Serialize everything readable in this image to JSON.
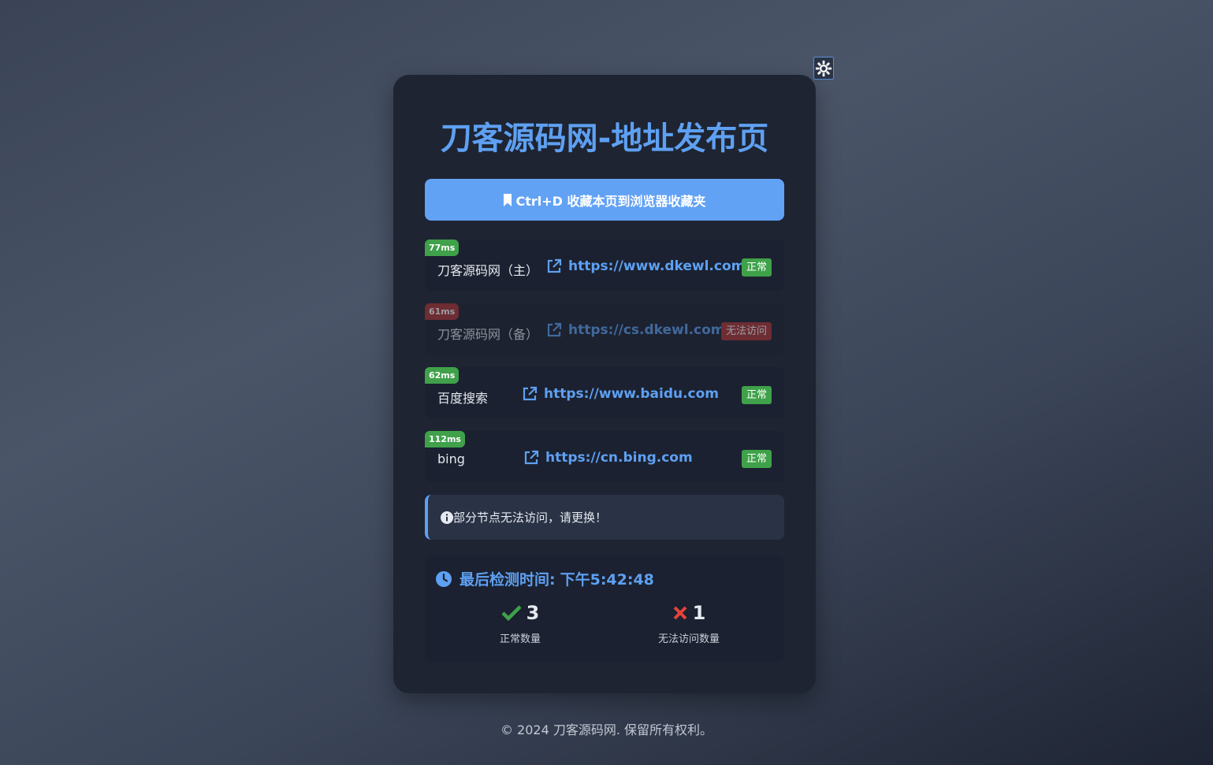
{
  "title": "刀客源码网-地址发布页",
  "bookmark": {
    "label": "Ctrl+D 收藏本页到浏览器收藏夹"
  },
  "links": [
    {
      "latency": "77ms",
      "name": "刀客源码网（主）",
      "url": "https://www.dkewl.com",
      "status": "正常"
    },
    {
      "latency": "61ms",
      "name": "刀客源码网（备）",
      "url": "https://cs.dkewl.com",
      "status": "无法访问"
    },
    {
      "latency": "62ms",
      "name": "百度搜索",
      "url": "https://www.baidu.com",
      "status": "正常"
    },
    {
      "latency": "112ms",
      "name": "bing",
      "url": "https://cn.bing.com",
      "status": "正常"
    }
  ],
  "notice": {
    "text": "部分节点无法访问，请更换！"
  },
  "stats": {
    "last_check_label": "最后检测时间:",
    "last_check_time": "下午5:42:48",
    "ok_count": "3",
    "ok_label": "正常数量",
    "bad_count": "1",
    "bad_label": "无法访问数量"
  },
  "footer": "© 2024 刀客源码网. 保留所有权利。",
  "colors": {
    "accent": "#5ea0f2",
    "ok": "#3fa14a",
    "bad": "#b03434"
  },
  "icons": [
    "gear-icon",
    "bookmark-icon",
    "external-link-icon",
    "info-icon",
    "clock-icon",
    "check-icon",
    "cross-icon"
  ]
}
